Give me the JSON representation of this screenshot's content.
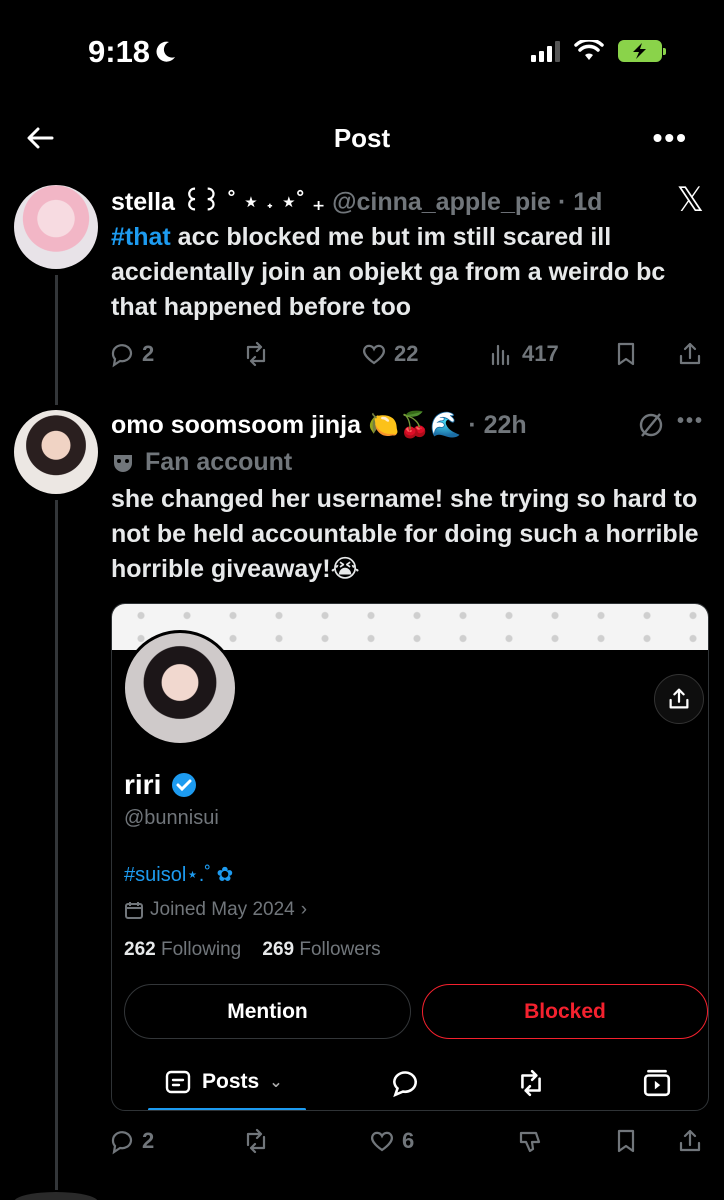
{
  "status_bar": {
    "time": "9:18"
  },
  "nav": {
    "title": "Post"
  },
  "tweet1": {
    "display_name": "stella ꒰꒱ ˚ ⋆ ˖ ⋆˚ ₊",
    "handle": "@cinna_apple_pie",
    "time": "· 1d",
    "hashtag": "#that",
    "text": " acc blocked me but im still scared ill accidentally join an objekt ga from a weirdo bc that happened before too",
    "replies": "2",
    "likes": "22",
    "views": "417"
  },
  "tweet2": {
    "display_name": "omo soomsoom jinja",
    "emojis": "🍋🍒🌊",
    "time": "· 22h",
    "label": "Fan account",
    "text": "she changed her username! she trying so hard to not be held accountable for doing such a horrible horrible giveaway!😭",
    "replies": "2",
    "likes": "6"
  },
  "profile_card": {
    "name": "riri",
    "handle": "@bunnisui",
    "bio": "#suisol⋆.˚ ✿",
    "joined": "Joined May 2024",
    "following_count": "262",
    "following_label": "Following",
    "followers_count": "269",
    "followers_label": "Followers",
    "mention_label": "Mention",
    "blocked_label": "Blocked",
    "posts_tab": "Posts"
  },
  "colors": {
    "accent": "#1d9bf0",
    "blocked": "#f4212e",
    "muted": "#71767b"
  }
}
